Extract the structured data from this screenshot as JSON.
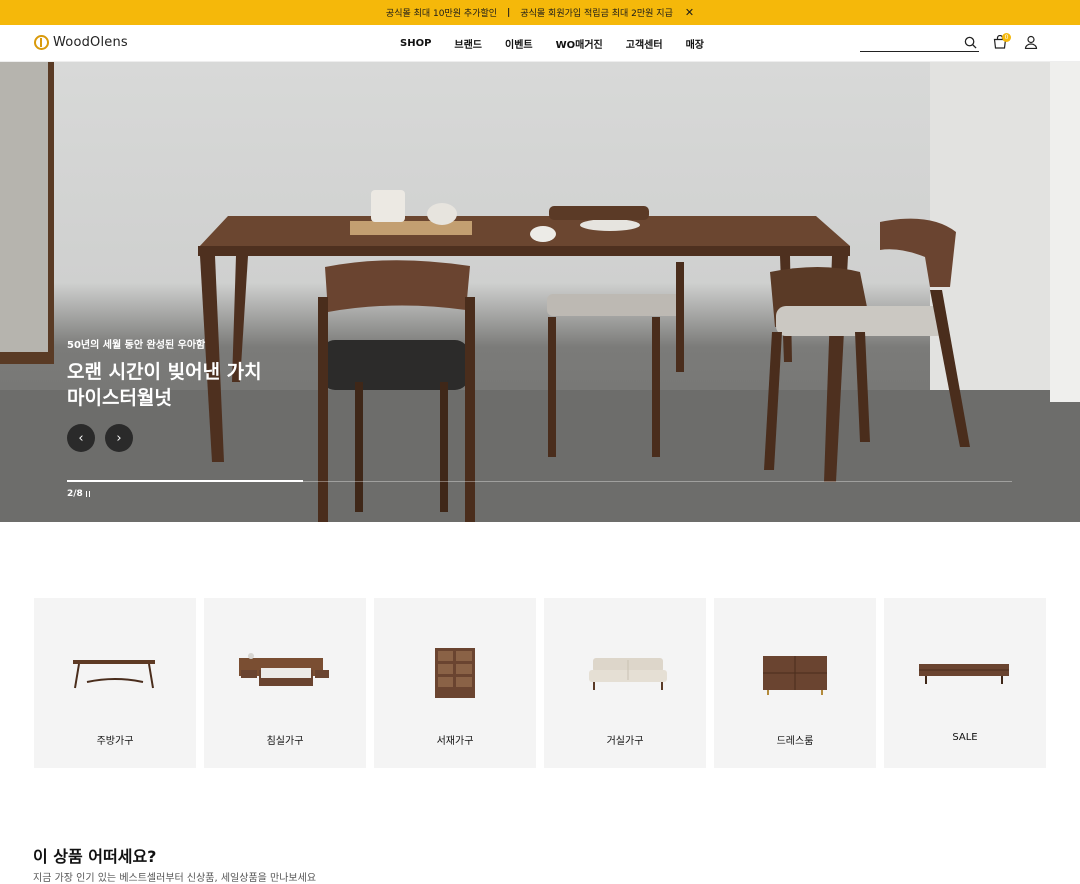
{
  "topbar": {
    "promo_1": "공식몰 최대 10만원 추가할인",
    "separator": "|",
    "promo_2": "공식몰 회원가입 적립금 최대 2만원 지급",
    "close_icon": "close-icon"
  },
  "header": {
    "logo_text": "WoodOlens",
    "nav": [
      "SHOP",
      "브랜드",
      "이벤트",
      "WO매거진",
      "고객센터",
      "매장"
    ],
    "search_placeholder": "",
    "cart_count": "0",
    "accent_color": "#f5b80a"
  },
  "hero": {
    "subtitle": "50년의 세월 동안 완성된 우아함",
    "title_line_1": "오랜 시간이 빚어낸 가치",
    "title_line_2": "마이스터월넛",
    "prev_icon": "chevron-left-icon",
    "next_icon": "chevron-right-icon",
    "pager": "2/8",
    "progress": 0.25
  },
  "categories": [
    {
      "label": "주방가구",
      "icon": "dining-table-image"
    },
    {
      "label": "침실가구",
      "icon": "bed-image"
    },
    {
      "label": "서재가구",
      "icon": "bookshelf-image"
    },
    {
      "label": "거실가구",
      "icon": "sofa-image"
    },
    {
      "label": "드레스룸",
      "icon": "dresser-image"
    },
    {
      "label": "SALE",
      "icon": "tv-console-image"
    }
  ],
  "recommend": {
    "title": "이 상품 어떠세요?",
    "subtitle": "지금 가장 인기 있는 베스트셀러부터 신상품, 세일상품을 만나보세요"
  }
}
